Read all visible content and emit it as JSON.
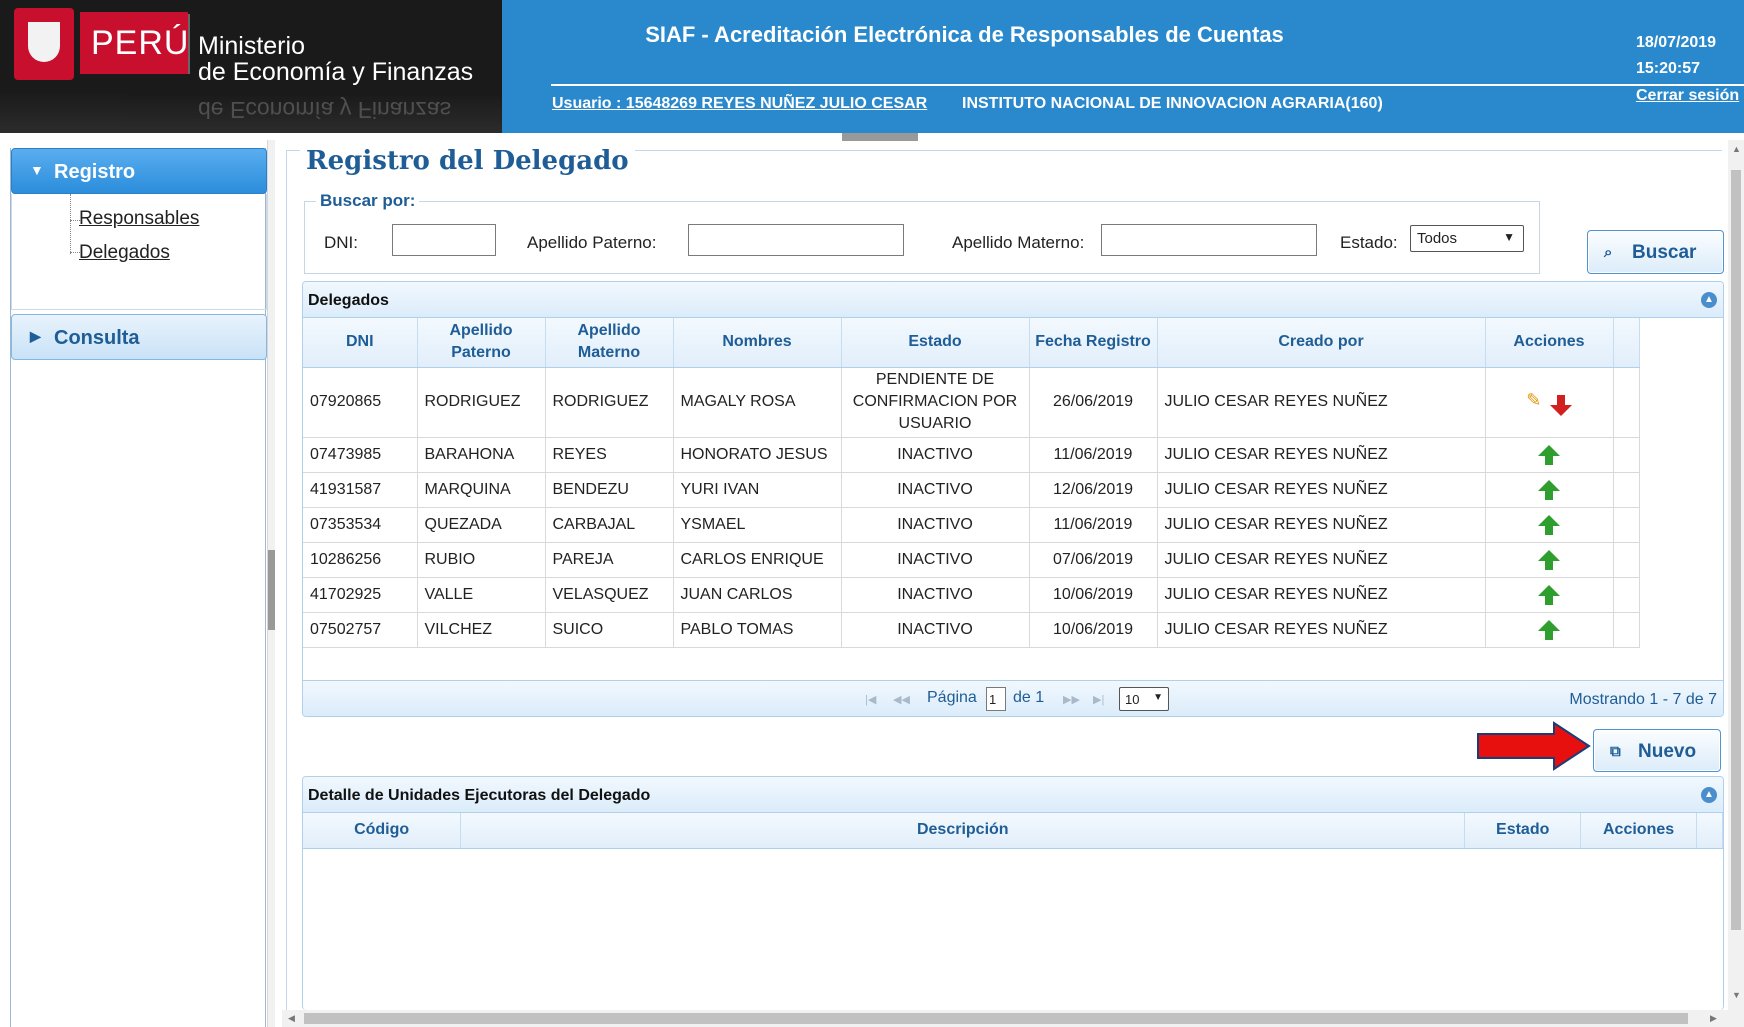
{
  "header": {
    "brand": "PERÚ",
    "ministry_line1": "Ministerio",
    "ministry_line2": "de Economía y Finanzas",
    "title": "SIAF - Acreditación Electrónica de Responsables de Cuentas",
    "user_link": "Usuario : 15648269 REYES NUÑEZ JULIO CESAR",
    "institution": "INSTITUTO NACIONAL DE INNOVACION AGRARIA(160)",
    "date": "18/07/2019",
    "time": "15:20:57",
    "logout": "Cerrar sesión"
  },
  "sidebar": {
    "sections": [
      {
        "label": "Registro",
        "expanded": true,
        "items": [
          "Responsables",
          "Delegados"
        ]
      },
      {
        "label": "Consulta",
        "expanded": false,
        "items": []
      }
    ]
  },
  "page": {
    "title": "Registro del Delegado",
    "search": {
      "legend": "Buscar por:",
      "dni_label": "DNI:",
      "dni_value": "",
      "apellido_paterno_label": "Apellido Paterno:",
      "apellido_paterno_value": "",
      "apellido_materno_label": "Apellido Materno:",
      "apellido_materno_value": "",
      "estado_label": "Estado:",
      "estado_value": "Todos",
      "buscar_button": "Buscar"
    },
    "delegados": {
      "title": "Delegados",
      "columns": [
        "DNI",
        "Apellido Paterno",
        "Apellido Materno",
        "Nombres",
        "Estado",
        "Fecha Registro",
        "Creado por",
        "Acciones"
      ],
      "rows": [
        {
          "dni": "07920865",
          "paterno": "RODRIGUEZ",
          "materno": "RODRIGUEZ",
          "nombres": "MAGALY ROSA",
          "estado": "PENDIENTE DE CONFIRMACION POR USUARIO",
          "fecha": "26/06/2019",
          "creado_por": "JULIO CESAR REYES NUÑEZ",
          "actions": [
            "edit-icon",
            "arrow-down-red-icon"
          ]
        },
        {
          "dni": "07473985",
          "paterno": "BARAHONA",
          "materno": "REYES",
          "nombres": "HONORATO JESUS",
          "estado": "INACTIVO",
          "fecha": "11/06/2019",
          "creado_por": "JULIO CESAR REYES NUÑEZ",
          "actions": [
            "arrow-up-green-icon"
          ]
        },
        {
          "dni": "41931587",
          "paterno": "MARQUINA",
          "materno": "BENDEZU",
          "nombres": "YURI IVAN",
          "estado": "INACTIVO",
          "fecha": "12/06/2019",
          "creado_por": "JULIO CESAR REYES NUÑEZ",
          "actions": [
            "arrow-up-green-icon"
          ]
        },
        {
          "dni": "07353534",
          "paterno": "QUEZADA",
          "materno": "CARBAJAL",
          "nombres": "YSMAEL",
          "estado": "INACTIVO",
          "fecha": "11/06/2019",
          "creado_por": "JULIO CESAR REYES NUÑEZ",
          "actions": [
            "arrow-up-green-icon"
          ]
        },
        {
          "dni": "10286256",
          "paterno": "RUBIO",
          "materno": "PAREJA",
          "nombres": "CARLOS ENRIQUE",
          "estado": "INACTIVO",
          "fecha": "07/06/2019",
          "creado_por": "JULIO CESAR REYES NUÑEZ",
          "actions": [
            "arrow-up-green-icon"
          ]
        },
        {
          "dni": "41702925",
          "paterno": "VALLE",
          "materno": "VELASQUEZ",
          "nombres": "JUAN CARLOS",
          "estado": "INACTIVO",
          "fecha": "10/06/2019",
          "creado_por": "JULIO CESAR REYES NUÑEZ",
          "actions": [
            "arrow-up-green-icon"
          ]
        },
        {
          "dni": "07502757",
          "paterno": "VILCHEZ",
          "materno": "SUICO",
          "nombres": "PABLO TOMAS",
          "estado": "INACTIVO",
          "fecha": "10/06/2019",
          "creado_por": "JULIO CESAR REYES NUÑEZ",
          "actions": [
            "arrow-up-green-icon"
          ]
        }
      ],
      "pager": {
        "page_label": "Página",
        "page_value": "1",
        "of_label": "de 1",
        "page_size": "10",
        "info": "Mostrando 1 - 7 de 7"
      }
    },
    "nuevo_button": "Nuevo",
    "detalle": {
      "title": "Detalle de Unidades Ejecutoras del Delegado",
      "columns": [
        "Código",
        "Descripción",
        "Estado",
        "Acciones"
      ]
    }
  },
  "colors": {
    "header_blue": "#2a89cc",
    "accent_blue": "#1f5d96",
    "brand_red": "#c8102e",
    "activate_green": "#2e9f2e",
    "deactivate_red": "#d21f1f"
  }
}
